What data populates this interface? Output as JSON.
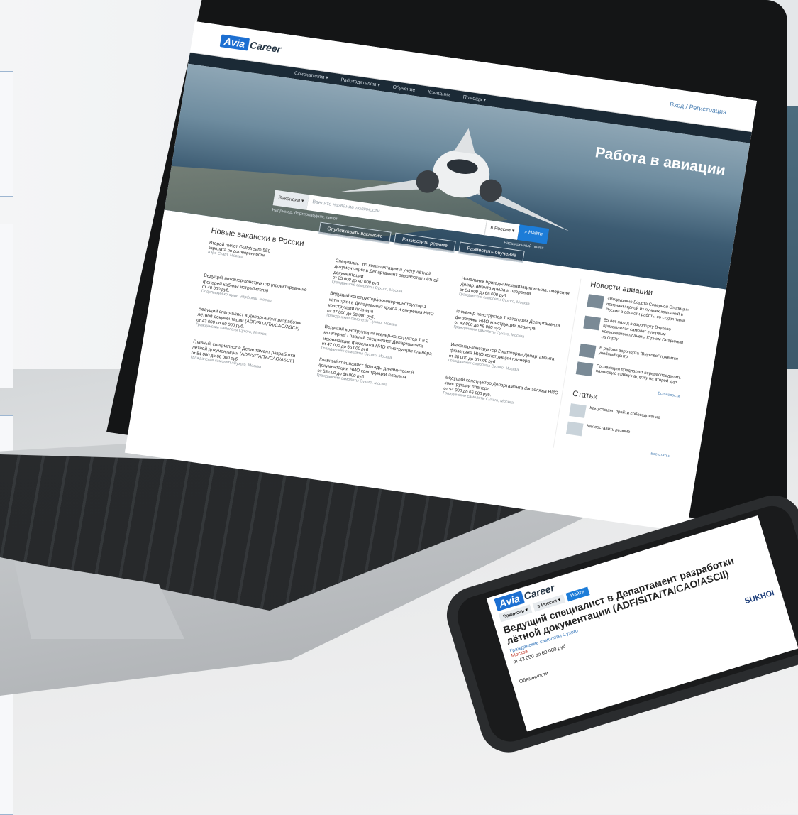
{
  "site": {
    "logo_box": "Avia",
    "logo_word": "Career",
    "auth": "Вход / Регистрация",
    "nav": [
      "Соискателям ▾",
      "Работодателям ▾",
      "Обучение",
      "Компании",
      "Помощь ▾"
    ]
  },
  "hero": {
    "title": "Работа в авиации",
    "search_category": "Вакансии ▾",
    "search_placeholder": "Введите название должности",
    "search_region": "в России ▾",
    "search_button": "Найти",
    "hint": "Например: бортпроводник, пилот",
    "advanced": "Расширенный поиск",
    "buttons": [
      "Опубликовать вакансию",
      "Разместить резюме",
      "Разместить обучение"
    ]
  },
  "jobs": {
    "title": "Новые вакансии в России",
    "items": [
      {
        "title": "Второй пилот Gulfstream 550",
        "salary": "зарплата по договоренности",
        "company": "Аэро Старт, Москва"
      },
      {
        "title": "Специалист по комплектации и учёту лётной документации в Департамент разработки лётной документации",
        "salary": "от 25 000 до 40 000 руб.",
        "company": "Гражданские самолеты Сухого, Москва"
      },
      {
        "title": "Начальник бригады механизации крыла, оперения Департамента крыла и оперения",
        "salary": "от 54 000 до 66 000 руб.",
        "company": "Гражданские самолеты Сухого, Москва"
      },
      {
        "title": "Ведущий инженер-конструктор (проектирование фонарей кабины истребителя)",
        "salary": "от 40 000 руб.",
        "company": "Подольский концерн Эйрфреш, Москва"
      },
      {
        "title": "Ведущий конструктор/инженер-конструктор 1 категории в Департамент крыла и оперения НИО конструкции планера",
        "salary": "от 47 000 до 66 000 руб.",
        "company": "Гражданские самолеты Сухого, Москва"
      },
      {
        "title": "Инженер-конструктор 1 категории Департамента фюзеляжа НИО конструкции планера",
        "salary": "от 43 000 до 58 000 руб.",
        "company": "Гражданские самолеты Сухого, Москва"
      },
      {
        "title": "Ведущий специалист в Департамент разработки лётной документации (ADF/SITA/TA/CAO/ASCII)",
        "salary": "от 43 000 до 60 000 руб.",
        "company": "Гражданские самолеты Сухого, Москва"
      },
      {
        "title": "Ведущий конструктор/инженер-конструктор 1 и 2 категории/ Главный специалист Департамента механизации фюзеляжа НИО конструкции планера",
        "salary": "от 47 000 до 66 000 руб.",
        "company": "Гражданские самолеты Сухого, Москва"
      },
      {
        "title": "Инженер-конструктор 2 категории Департамента фюзеляжа НИО конструкции планера",
        "salary": "от 38 000 до 50 000 руб.",
        "company": "Гражданские самолеты Сухого, Москва"
      },
      {
        "title": "Главный специалист в Департамент разработки лётной документации (ADF/SITA/TA/CAO/ASCII)",
        "salary": "от 54 000 до 66 000 руб.",
        "company": "Гражданские самолеты Сухого, Москва"
      },
      {
        "title": "Главный специалист бригады динамической документации НИО конструкции планера",
        "salary": "от 55 000 до 66 000 руб.",
        "company": "Гражданские самолеты Сухого, Москва"
      },
      {
        "title": "Ведущий конструктор Департамента фюзеляжа НИО конструкции планера",
        "salary": "от 54 000 до 66 000 руб.",
        "company": "Гражданские самолеты Сухого, Москва"
      }
    ]
  },
  "news": {
    "title": "Новости авиации",
    "items": [
      "«Воздушные Ворота Северной Столицы» признаны одной из лучших компаний в России в области работы со студентами",
      "55 лет назад в аэропорту Внуково приземлился самолет с первым космонавтом планеты Юрием Гагариным на борту",
      "В районе аэропорта \"Внуково\" появится учебный центр",
      "Росавиация предлагает перераспределить налоговую ставку нагрузку на второй круг"
    ],
    "all_link": "Все новости"
  },
  "articles": {
    "title": "Статьи",
    "items": [
      "Как успешно пройти собеседование",
      "Как составить резюме"
    ],
    "all_link": "Все статьи"
  },
  "phone": {
    "logo_box": "Avia",
    "logo_word": "Career",
    "search_category": "Вакансии ▾",
    "search_region": "в России ▾",
    "search_button": "Найти",
    "title": "Ведущий специалист в Департамент разработки лётной документации (ADF/SITA/TA/CAO/ASCII)",
    "company": "Гражданские самолеты Сухого",
    "salary": "от 43 000 до 60 000 руб.",
    "location": "Москва",
    "duties": "Обязанности:",
    "brand": "SUKHOI"
  }
}
